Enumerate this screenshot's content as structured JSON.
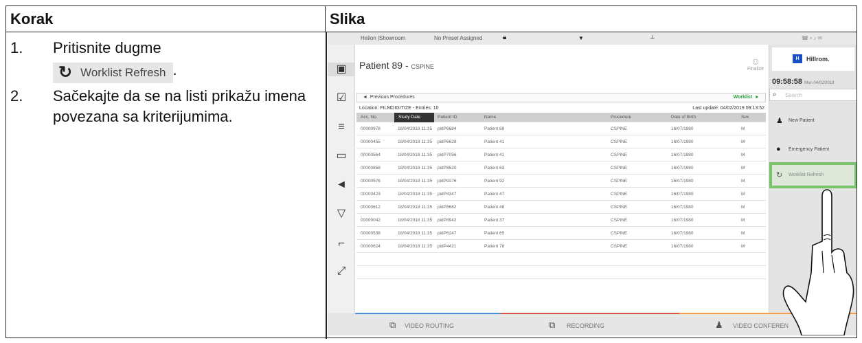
{
  "table": {
    "col_step": "Korak",
    "col_image": "Slika"
  },
  "steps": [
    {
      "num": "1.",
      "text": "Pritisnite dugme",
      "button_label": "Worklist Refresh",
      "after": "."
    },
    {
      "num": "2.",
      "text": "Sačekajte da se na listi prikažu imena povezana sa kriterijumima."
    }
  ],
  "screen": {
    "topbar": {
      "room": "Helion |Showroom",
      "preset": "No Preset Assigned"
    },
    "patient": {
      "name": "Patient 89 - ",
      "proc": "CSPINE"
    },
    "finalize": "Finalize",
    "previous_procedures": "Previous Procedures",
    "worklist_link": "Worklist",
    "location": "Location: FILMDIGITIZE - Entries: 10",
    "last_update": "Last update: 04/02/2019 09:13:52",
    "columns": [
      "Acc. No.",
      "Study Date",
      "Patient ID",
      "Name",
      "Procedure",
      "Date of Birth",
      "Sex"
    ],
    "rows": [
      [
        "00000978",
        "18/04/2018 11:35",
        "pidP6684",
        "Patient 89",
        "CSPINE",
        "16/07/1980",
        "M"
      ],
      [
        "00000455",
        "18/04/2018 11:35",
        "pidP6628",
        "Patient 41",
        "CSPINE",
        "16/07/1980",
        "M"
      ],
      [
        "00000564",
        "18/04/2018 11:35",
        "pidP7056",
        "Patient 41",
        "CSPINE",
        "16/07/1980",
        "M"
      ],
      [
        "00000858",
        "18/04/2018 11:35",
        "pidP8520",
        "Patient 63",
        "CSPINE",
        "16/07/1980",
        "M"
      ],
      [
        "00000576",
        "18/04/2018 11:35",
        "pidP9276",
        "Patient 92",
        "CSPINE",
        "16/07/1980",
        "M"
      ],
      [
        "00000423",
        "18/04/2018 11:35",
        "pidP3347",
        "Patient 47",
        "CSPINE",
        "16/07/1980",
        "M"
      ],
      [
        "00000612",
        "18/04/2018 11:35",
        "pidP8682",
        "Patient 48",
        "CSPINE",
        "16/07/1980",
        "M"
      ],
      [
        "00000042",
        "18/04/2018 11:35",
        "pidP8942",
        "Patient 37",
        "CSPINE",
        "16/07/1980",
        "M"
      ],
      [
        "00000538",
        "18/04/2018 11:35",
        "pidP6247",
        "Patient 65",
        "CSPINE",
        "16/07/1980",
        "M"
      ],
      [
        "00000624",
        "18/04/2018 11:35",
        "pidP4421",
        "Patient 78",
        "CSPINE",
        "16/07/1980",
        "M"
      ]
    ],
    "brand": {
      "badge": "H",
      "name": "Hillrom."
    },
    "clock": {
      "time": "09:58:58",
      "date": "Mon 04/02/2019"
    },
    "search_placeholder": "Search",
    "buttons": {
      "new_patient": "New Patient",
      "emergency_patient": "Emergency Patient",
      "worklist_refresh": "Worklist Refresh"
    },
    "bottom": {
      "video_routing": "VIDEO ROUTING",
      "recording": "RECORDING",
      "video_conference": "VIDEO CONFEREN"
    },
    "icons": [
      "patient-card-icon",
      "checklist-icon",
      "stack-icon",
      "monitor-icon",
      "speaker-icon",
      "surgical-light-icon",
      "table-icon",
      "expand-icon"
    ],
    "colors": {
      "highlight": "#7cc36e",
      "accent_green": "#2a9d3a",
      "routing": "#4a8fd6",
      "recording": "#d9534f",
      "conference": "#f0a04b",
      "brand": "#1b4fc4"
    }
  }
}
